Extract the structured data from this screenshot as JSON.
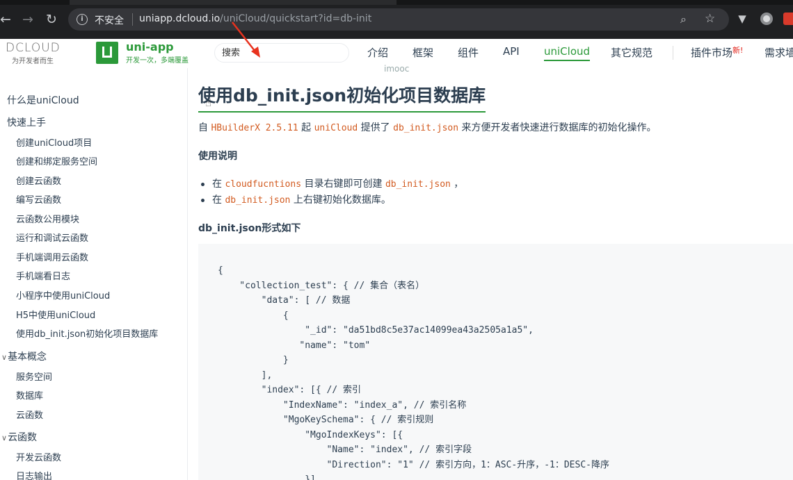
{
  "browser": {
    "security_label": "不安全",
    "url_host": "uniapp.dcloud.io",
    "url_path": "/uniCloud/quickstart?id=db-init"
  },
  "header": {
    "dcloud_logo": "DCLOUD",
    "dcloud_slogan": "为开发者而生",
    "uni_name": "uni-app",
    "uni_tagline": "开发一次，多端覆盖",
    "search_placeholder": "搜索",
    "nav": [
      "介绍",
      "框架",
      "组件",
      "API",
      "uniCloud",
      "其它规范",
      "插件市场",
      "需求墙"
    ],
    "new_badge": "新!",
    "watermark": "imooc"
  },
  "sidebar": {
    "items": [
      {
        "label": "什么是uniCloud",
        "level": 1
      },
      {
        "label": "快速上手",
        "level": 1
      },
      {
        "label": "创建uniCloud项目",
        "level": 2
      },
      {
        "label": "创建和绑定服务空间",
        "level": 2
      },
      {
        "label": "创建云函数",
        "level": 2
      },
      {
        "label": "编写云函数",
        "level": 2
      },
      {
        "label": "云函数公用模块",
        "level": 2
      },
      {
        "label": "运行和调试云函数",
        "level": 2
      },
      {
        "label": "手机端调用云函数",
        "level": 2
      },
      {
        "label": "手机端看日志",
        "level": 2
      },
      {
        "label": "小程序中使用uniCloud",
        "level": 2
      },
      {
        "label": "H5中使用uniCloud",
        "level": 2
      },
      {
        "label": "使用db_init.json初始化项目数据库",
        "level": 2
      },
      {
        "label": "基本概念",
        "level": 1
      },
      {
        "label": "服务空间",
        "level": 2
      },
      {
        "label": "数据库",
        "level": 2
      },
      {
        "label": "云函数",
        "level": 2
      },
      {
        "label": "云函数",
        "level": 1
      },
      {
        "label": "开发云函数",
        "level": 2
      },
      {
        "label": "日志输出",
        "level": 2
      }
    ]
  },
  "content": {
    "title": "使用db_init.json初始化项目数据库",
    "intro": {
      "p1": "自 ",
      "c1": "HBuilderX 2.5.11",
      "p2": " 起 ",
      "c2": "uniCloud",
      "p3": " 提供了 ",
      "c3": "db_init.json",
      "p4": " 来方便开发者快速进行数据库的初始化操作。"
    },
    "usage_heading": "使用说明",
    "bullets": [
      {
        "pre": "在 ",
        "code": "cloudfucntions",
        "post": " 目录右键即可创建 ",
        "code2": "db_init.json",
        "post2": " ，"
      },
      {
        "pre": "在 ",
        "code": "db_init.json",
        "post": " 上右键初始化数据库。",
        "code2": "",
        "post2": ""
      }
    ],
    "format_heading": "db_init.json形式如下",
    "code": "{\n    \"collection_test\": { // 集合（表名）\n        \"data\": [ // 数据\n            {\n                \"_id\": \"da51bd8c5e37ac14099ea43a2505a1a5\",\n               \"name\": \"tom\"\n            }\n        ],\n        \"index\": [{ // 索引\n            \"IndexName\": \"index_a\", // 索引名称\n            \"MgoKeySchema\": { // 索引规则\n                \"MgoIndexKeys\": [{\n                    \"Name\": \"index\", // 索引字段\n                    \"Direction\": \"1\" // 索引方向，1：ASC-升序，-1：DESC-降序\n                }]"
  }
}
